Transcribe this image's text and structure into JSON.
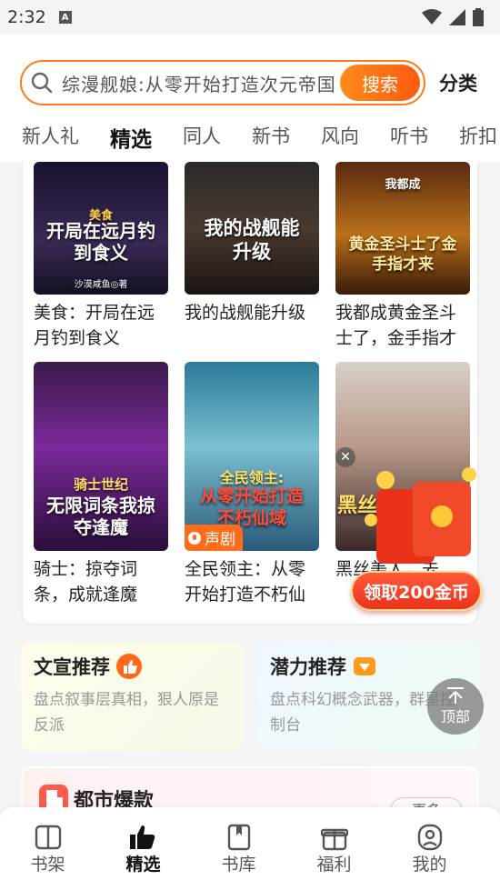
{
  "status_bar": {
    "time": "2:32",
    "icons": [
      "a-icon",
      "wifi-icon",
      "signal-icon",
      "battery-icon"
    ]
  },
  "search": {
    "query": "综漫舰娘:从零开始打造次元帝国",
    "button_label": "搜索",
    "category_label": "分类"
  },
  "tabs": [
    {
      "label": "新人礼",
      "active": false
    },
    {
      "label": "精选",
      "active": true
    },
    {
      "label": "同人",
      "active": false
    },
    {
      "label": "新书",
      "active": false
    },
    {
      "label": "风向",
      "active": false
    },
    {
      "label": "听书",
      "active": false
    },
    {
      "label": "折扣",
      "active": false
    }
  ],
  "books": [
    {
      "title": "美食：开局在远月钓到食义",
      "cover_text": "开局在远月钓到食义",
      "cover_tag": "美食",
      "author_on_cover": "沙漠咸鱼◎著",
      "audio": false
    },
    {
      "title": "我的战舰能升级",
      "cover_text": "我的战舰能升级",
      "cover_tag": "",
      "author_on_cover": "",
      "audio": false
    },
    {
      "title": "我都成黄金圣斗士了，金手指才来",
      "cover_text": "黄金圣斗士了金手指才来",
      "cover_tag": "我都成",
      "author_on_cover": "",
      "audio": false
    },
    {
      "title": "骑士：掠夺词条，成就逢魔",
      "cover_text": "无限词条我掠夺逢魔",
      "cover_tag": "骑士世纪",
      "author_on_cover": "",
      "audio": false
    },
    {
      "title": "全民领主：从零开始打造不朽仙域",
      "cover_text": "从零开始打造不朽仙域",
      "cover_tag": "全民领主:",
      "author_on_cover": "",
      "audio": true,
      "audio_label": "声剧"
    },
    {
      "title": "黑丝美人，去",
      "cover_text": "黑丝",
      "cover_tag": "",
      "author_on_cover": "",
      "audio": false
    }
  ],
  "promo": {
    "label": "领取200金币"
  },
  "recommendations": [
    {
      "title": "文宣推荐",
      "icon": "thumbs-up-icon",
      "desc": "盘点叙事层真相，狠人原是反派"
    },
    {
      "title": "潜力推荐",
      "icon": "diamond-icon",
      "desc": "盘点科幻概念武器，群星控制台"
    }
  ],
  "top_button": {
    "label": "顶部"
  },
  "city_section": {
    "title": "都市爆款",
    "more_label": "更多"
  },
  "bottom_nav": [
    {
      "label": "书架",
      "icon": "bookshelf-icon",
      "active": false
    },
    {
      "label": "精选",
      "icon": "thumbs-up-icon",
      "active": true
    },
    {
      "label": "书库",
      "icon": "library-icon",
      "active": false
    },
    {
      "label": "福利",
      "icon": "gift-icon",
      "active": false
    },
    {
      "label": "我的",
      "icon": "user-icon",
      "active": false
    }
  ],
  "colors": {
    "accent": "#ff6d1a",
    "nav_active": "#dff700",
    "promo_red": "#e8331a"
  }
}
